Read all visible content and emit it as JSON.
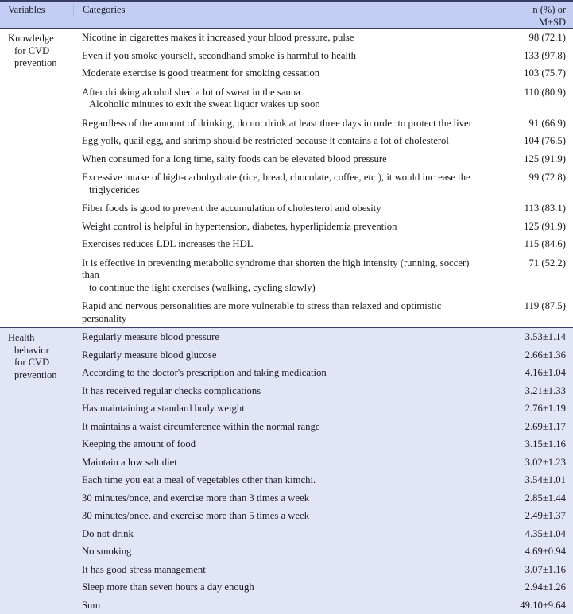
{
  "table": {
    "columns": {
      "variables": "Variables",
      "categories": "Categories",
      "value_line1": "n (%) or",
      "value_line2": "M±SD"
    },
    "sections": [
      {
        "id": "knowledge",
        "variable_lines": [
          "Knowledge",
          "for CVD",
          "prevention"
        ],
        "rows": [
          {
            "category": "Nicotine in cigarettes makes it increased your blood pressure, pulse",
            "continuation": "",
            "value": "98 (72.1)"
          },
          {
            "category": "Even if you smoke yourself, secondhand smoke is harmful to health",
            "continuation": "",
            "value": "133 (97.8)"
          },
          {
            "category": "Moderate exercise is good treatment for smoking cessation",
            "continuation": "",
            "value": "103 (75.7)"
          },
          {
            "category": "After drinking alcohol shed a lot of sweat in the sauna",
            "continuation": "Alcoholic minutes to exit the sweat liquor wakes up soon",
            "value": "110 (80.9)"
          },
          {
            "category": "Regardless of the amount of drinking, do not drink at least three days in order to protect the liver",
            "continuation": "",
            "value": "91 (66.9)"
          },
          {
            "category": "Egg yolk, quail egg, and shrimp should be restricted because it contains a lot of cholesterol",
            "continuation": "",
            "value": "104 (76.5)"
          },
          {
            "category": "When consumed for a long time, salty foods can be elevated blood pressure",
            "continuation": "",
            "value": "125 (91.9)"
          },
          {
            "category": "Excessive intake of high-carbohydrate (rice, bread, chocolate, coffee, etc.), it would increase the",
            "continuation": "triglycerides",
            "value": "99 (72.8)"
          },
          {
            "category": "Fiber foods is good to prevent the accumulation of cholesterol and obesity",
            "continuation": "",
            "value": "113 (83.1)"
          },
          {
            "category": "Weight control is helpful in hypertension, diabetes, hyperlipidemia prevention",
            "continuation": "",
            "value": "125 (91.9)"
          },
          {
            "category": "Exercises reduces LDL increases the HDL",
            "continuation": "",
            "value": "115 (84.6)"
          },
          {
            "category": "It is effective in preventing metabolic syndrome that shorten the high intensity (running, soccer) than",
            "continuation": "to continue the light exercises (walking, cycling slowly)",
            "value": "71 (52.2)"
          },
          {
            "category": "Rapid and nervous personalities are more vulnerable to stress than relaxed and optimistic personality",
            "continuation": "",
            "value": "119 (87.5)"
          }
        ]
      },
      {
        "id": "health",
        "variable_lines": [
          "Health",
          "behavior",
          "for CVD",
          "prevention"
        ],
        "rows": [
          {
            "category": "Regularly measure blood pressure",
            "continuation": "",
            "value": "3.53±1.14"
          },
          {
            "category": "Regularly measure blood glucose",
            "continuation": "",
            "value": "2.66±1.36"
          },
          {
            "category": "According to the doctor's prescription and taking medication",
            "continuation": "",
            "value": "4.16±1.04"
          },
          {
            "category": "It has received regular checks complications",
            "continuation": "",
            "value": "3.21±1.33"
          },
          {
            "category": "Has maintaining a standard body weight",
            "continuation": "",
            "value": "2.76±1.19"
          },
          {
            "category": "It maintains a waist circumference within the normal range",
            "continuation": "",
            "value": "2.69±1.17"
          },
          {
            "category": "Keeping the amount of food",
            "continuation": "",
            "value": "3.15±1.16"
          },
          {
            "category": "Maintain a low salt diet",
            "continuation": "",
            "value": "3.02±1.23"
          },
          {
            "category": "Each time you eat a meal of vegetables other than kimchi.",
            "continuation": "",
            "value": "3.54±1.01"
          },
          {
            "category": "30 minutes/once, and exercise more than 3 times a week",
            "continuation": "",
            "value": "2.85±1.44"
          },
          {
            "category": "30 minutes/once, and exercise more than 5 times a week",
            "continuation": "",
            "value": "2.49±1.37"
          },
          {
            "category": "Do not drink",
            "continuation": "",
            "value": "4.35±1.04"
          },
          {
            "category": "No smoking",
            "continuation": "",
            "value": "4.69±0.94"
          },
          {
            "category": "It has good stress management",
            "continuation": "",
            "value": "3.07±1.16"
          },
          {
            "category": "Sleep more than seven hours a day enough",
            "continuation": "",
            "value": "2.94±1.26"
          },
          {
            "category": "Sum",
            "continuation": "",
            "value": "49.10±9.64"
          }
        ]
      }
    ]
  },
  "colors": {
    "header_band": "#c3cef5",
    "section_shade": "#e2e4f7",
    "rule": "#3a3f66",
    "text": "#16161f"
  }
}
